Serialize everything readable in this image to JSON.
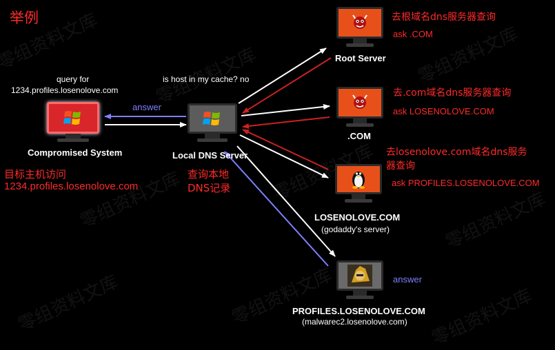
{
  "title": "举例",
  "watermark": "零组资料文库",
  "nodes": {
    "compromised": {
      "query_line1": "query for",
      "query_line2": "1234.profiles.losenolove.com",
      "label": "Compromised System",
      "note_line1": "目标主机访问",
      "note_line2": "1234.profiles.losenolove.com"
    },
    "local_dns": {
      "cache_question": "is host in my cache? no",
      "label": "Local DNS Server",
      "note_line1": "查询本地",
      "note_line2": "DNS记录",
      "answer_label": "answer"
    },
    "root": {
      "label": "Root Server",
      "note_line1": "去根域名dns服务器查询",
      "note_line2": "ask .COM"
    },
    "com": {
      "label": ".COM",
      "note_line1": "去.com域名dns服务器查询",
      "note_line2": "ask LOSENOLOVE.COM"
    },
    "losenolove": {
      "label": "LOSENOLOVE.COM",
      "sublabel": "(godaddy's server)",
      "note_line1": "去losenolove.com域名dns服务",
      "note_line2": "器查询",
      "note_line3": "ask PROFILES.LOSENOLOVE.COM"
    },
    "profiles": {
      "label": "PROFILES.LOSENOLOVE.COM",
      "sublabel": "(malwarec2.losenolove.com)",
      "answer_label": "answer"
    }
  },
  "colors": {
    "background": "#000000",
    "annotation_red": "#ff2a2a",
    "answer_blue": "#7f7fff",
    "arrow_white": "#ffffff",
    "arrow_red": "#cc2222",
    "monitor_orange": "#e8501a",
    "monitor_gray": "#6a6a6a"
  },
  "icons": {
    "compromised": "windows-logo-icon",
    "local_dns": "windows-logo-icon",
    "root": "bsd-daemon-icon",
    "com": "bsd-daemon-icon",
    "losenolove": "linux-penguin-icon",
    "profiles": "avatar-icon"
  }
}
